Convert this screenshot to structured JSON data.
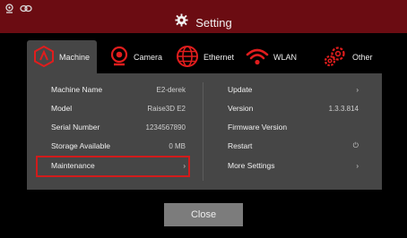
{
  "header": {
    "title": "Setting",
    "status_icons": [
      "camera-icon",
      "link-icon"
    ]
  },
  "tabs": [
    {
      "label": "Machine",
      "icon": "machine-icon",
      "active": true
    },
    {
      "label": "Camera",
      "icon": "camera-icon",
      "active": false
    },
    {
      "label": "Ethernet",
      "icon": "ethernet-icon",
      "active": false
    },
    {
      "label": "WLAN",
      "icon": "wifi-icon",
      "active": false
    },
    {
      "label": "Other",
      "icon": "gears-icon",
      "active": false
    }
  ],
  "left_list": [
    {
      "label": "Machine Name",
      "value": "E2-derek"
    },
    {
      "label": "Model",
      "value": "Raise3D E2"
    },
    {
      "label": "Serial Number",
      "value": "1234567890"
    },
    {
      "label": "Storage Available",
      "value": "0 MB"
    },
    {
      "label": "Maintenance",
      "value": "›"
    }
  ],
  "right_list": [
    {
      "label": "Update",
      "value": "›"
    },
    {
      "label": "Version",
      "value": "1.3.3.814"
    },
    {
      "label": "Firmware Version",
      "value": ""
    },
    {
      "label": "Restart",
      "value": "⏻"
    },
    {
      "label": "More Settings",
      "value": "›"
    }
  ],
  "footer": {
    "close_label": "Close"
  },
  "colors": {
    "header_bg": "#6b0c12",
    "accent_red": "#d21b1b",
    "panel_bg": "#464646"
  }
}
